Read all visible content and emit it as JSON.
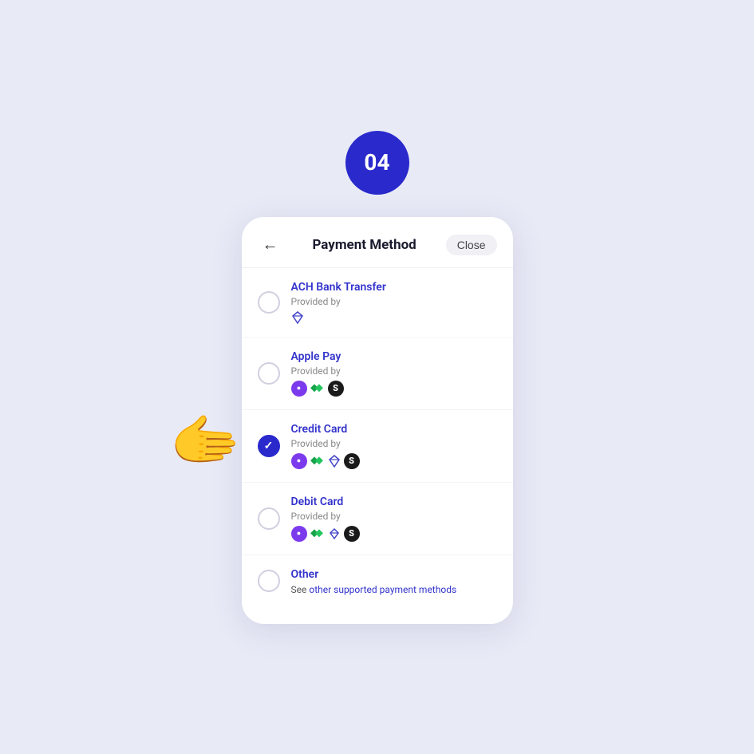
{
  "step": {
    "number": "04"
  },
  "header": {
    "back_label": "←",
    "title": "Payment Method",
    "close_label": "Close"
  },
  "payment_methods": [
    {
      "id": "ach",
      "name": "ACH Bank Transfer",
      "provider_label": "Provided by",
      "selected": false,
      "icons": [
        "diamond"
      ]
    },
    {
      "id": "apple_pay",
      "name": "Apple Pay",
      "provider_label": "Provided by",
      "selected": false,
      "icons": [
        "purple-dot",
        "green-diamond",
        "stripe"
      ]
    },
    {
      "id": "credit_card",
      "name": "Credit Card",
      "provider_label": "Provided by",
      "selected": true,
      "icons": [
        "purple-dot",
        "green-diamond",
        "diamond",
        "stripe"
      ]
    },
    {
      "id": "debit_card",
      "name": "Debit Card",
      "provider_label": "Provided by",
      "selected": false,
      "icons": [
        "purple-dot",
        "green-diamond",
        "diamond-small",
        "stripe"
      ]
    }
  ],
  "other": {
    "name": "Other",
    "description": "See",
    "link_text": "other supported payment methods"
  }
}
